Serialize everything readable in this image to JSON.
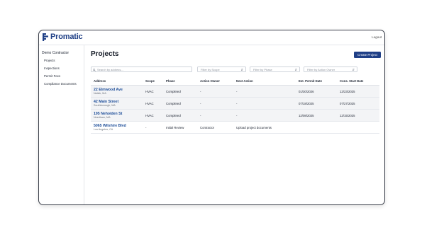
{
  "app": {
    "brand": "Promatic",
    "logout_label": "Logout",
    "accent_color": "#1f3f86"
  },
  "sidebar": {
    "org_name": "Demo Contractor",
    "items": [
      {
        "label": "Projects"
      },
      {
        "label": "Inspections"
      },
      {
        "label": "Permit Fees"
      },
      {
        "label": "Compliance Documents"
      }
    ]
  },
  "main": {
    "title": "Projects",
    "create_button": "Create Project",
    "filters": {
      "search_placeholder": "Search by address...",
      "scope_placeholder": "Filter by Scope",
      "phase_placeholder": "Filter by Phase",
      "owner_placeholder": "Filter by Action Owner"
    },
    "table": {
      "headers": [
        "Address",
        "Scope",
        "Phase",
        "Action Owner",
        "Next Action",
        "Est. Permit Date",
        "Cons. Start Date"
      ],
      "rows": [
        {
          "address": "22 Elmwood Ave",
          "city": "Natick, MA",
          "scope": "HVAC",
          "phase": "Completed",
          "owner": "-",
          "next": "-",
          "permit": "01/30/2026",
          "start": "12/23/2025"
        },
        {
          "address": "42 Main Street",
          "city": "Southborough, MA",
          "scope": "HVAC",
          "phase": "Completed",
          "owner": "-",
          "next": "-",
          "permit": "07/18/2025",
          "start": "07/27/2025"
        },
        {
          "address": "195 Nehoiden St",
          "city": "Needham, MA",
          "scope": "HVAC",
          "phase": "Completed",
          "owner": "-",
          "next": "-",
          "permit": "12/08/2025",
          "start": "12/15/2025"
        },
        {
          "address": "5065 Wilshire Blvd",
          "city": "Los Angeles, CA",
          "scope": "-",
          "phase": "Initial Review",
          "owner": "Contractor",
          "next": "Upload project documents",
          "permit": "",
          "start": ""
        }
      ]
    }
  }
}
